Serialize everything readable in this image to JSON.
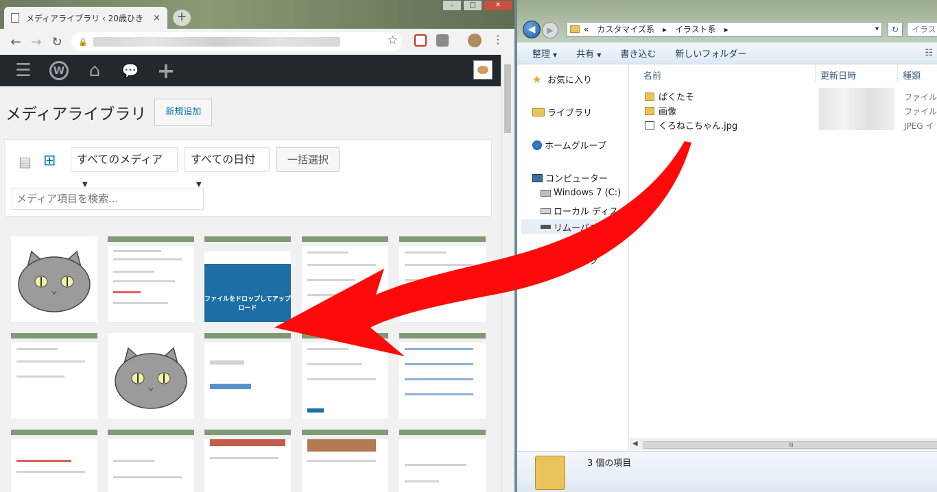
{
  "browser": {
    "tab_title": "メディアライブラリ ‹ 20歳ひき",
    "tab_close": "×",
    "new_tab": "+",
    "nav": {
      "back": "←",
      "forward": "→",
      "reload": "↻",
      "lock": "🔒",
      "star": "☆",
      "menu": "⋮"
    },
    "window_controls": {
      "minimize": "–",
      "maximize": "□",
      "close": "✕"
    }
  },
  "wp_admin_bar": {
    "menu_icon": "☰",
    "logo": "W",
    "home_icon": "⌂",
    "comment_icon": "💬",
    "add_icon": "+"
  },
  "media_library": {
    "title": "メディアライブラリ",
    "add_new": "新規追加",
    "view_list_icon": "▤",
    "view_grid_icon": "⊞",
    "filter_media": "すべてのメディア",
    "filter_date": "すべての日付",
    "bulk_select": "一括選択",
    "search_placeholder": "メディア項目を検索...",
    "upload_drop_text": "ファイルをドロップしてアップロード"
  },
  "explorer": {
    "back": "◀",
    "forward": "▶",
    "address": [
      "«",
      "カスタマイズ系",
      "▸",
      "イラスト系",
      "▸"
    ],
    "address_caret": "▾",
    "refresh": "↻",
    "search_placeholder": "イラス",
    "commands": [
      {
        "label": "整理",
        "dropdown": true
      },
      {
        "label": "共有",
        "dropdown": true
      },
      {
        "label": "書き込む",
        "dropdown": false
      },
      {
        "label": "新しいフォルダー",
        "dropdown": false
      }
    ],
    "nav": {
      "favorites": "お気に入り",
      "libraries": "ライブラリ",
      "homegroup": "ホームグループ",
      "computer": "コンピューター",
      "drive_c": "Windows 7 (C:)",
      "local_disk": "ローカル ディスク",
      "removable": "リムーバブル デ",
      "network": "ネットワーク"
    },
    "columns": {
      "name": "名前",
      "modified": "更新日時",
      "type": "種類"
    },
    "files": [
      {
        "name": "ぱくたそ",
        "type": "ファイル"
      },
      {
        "name": "画像",
        "type": "ファイル"
      },
      {
        "name": "くろねこちゃん.jpg",
        "type": "JPEG イ"
      }
    ],
    "hscroll_grip": "III",
    "status": "3 個の項目"
  }
}
